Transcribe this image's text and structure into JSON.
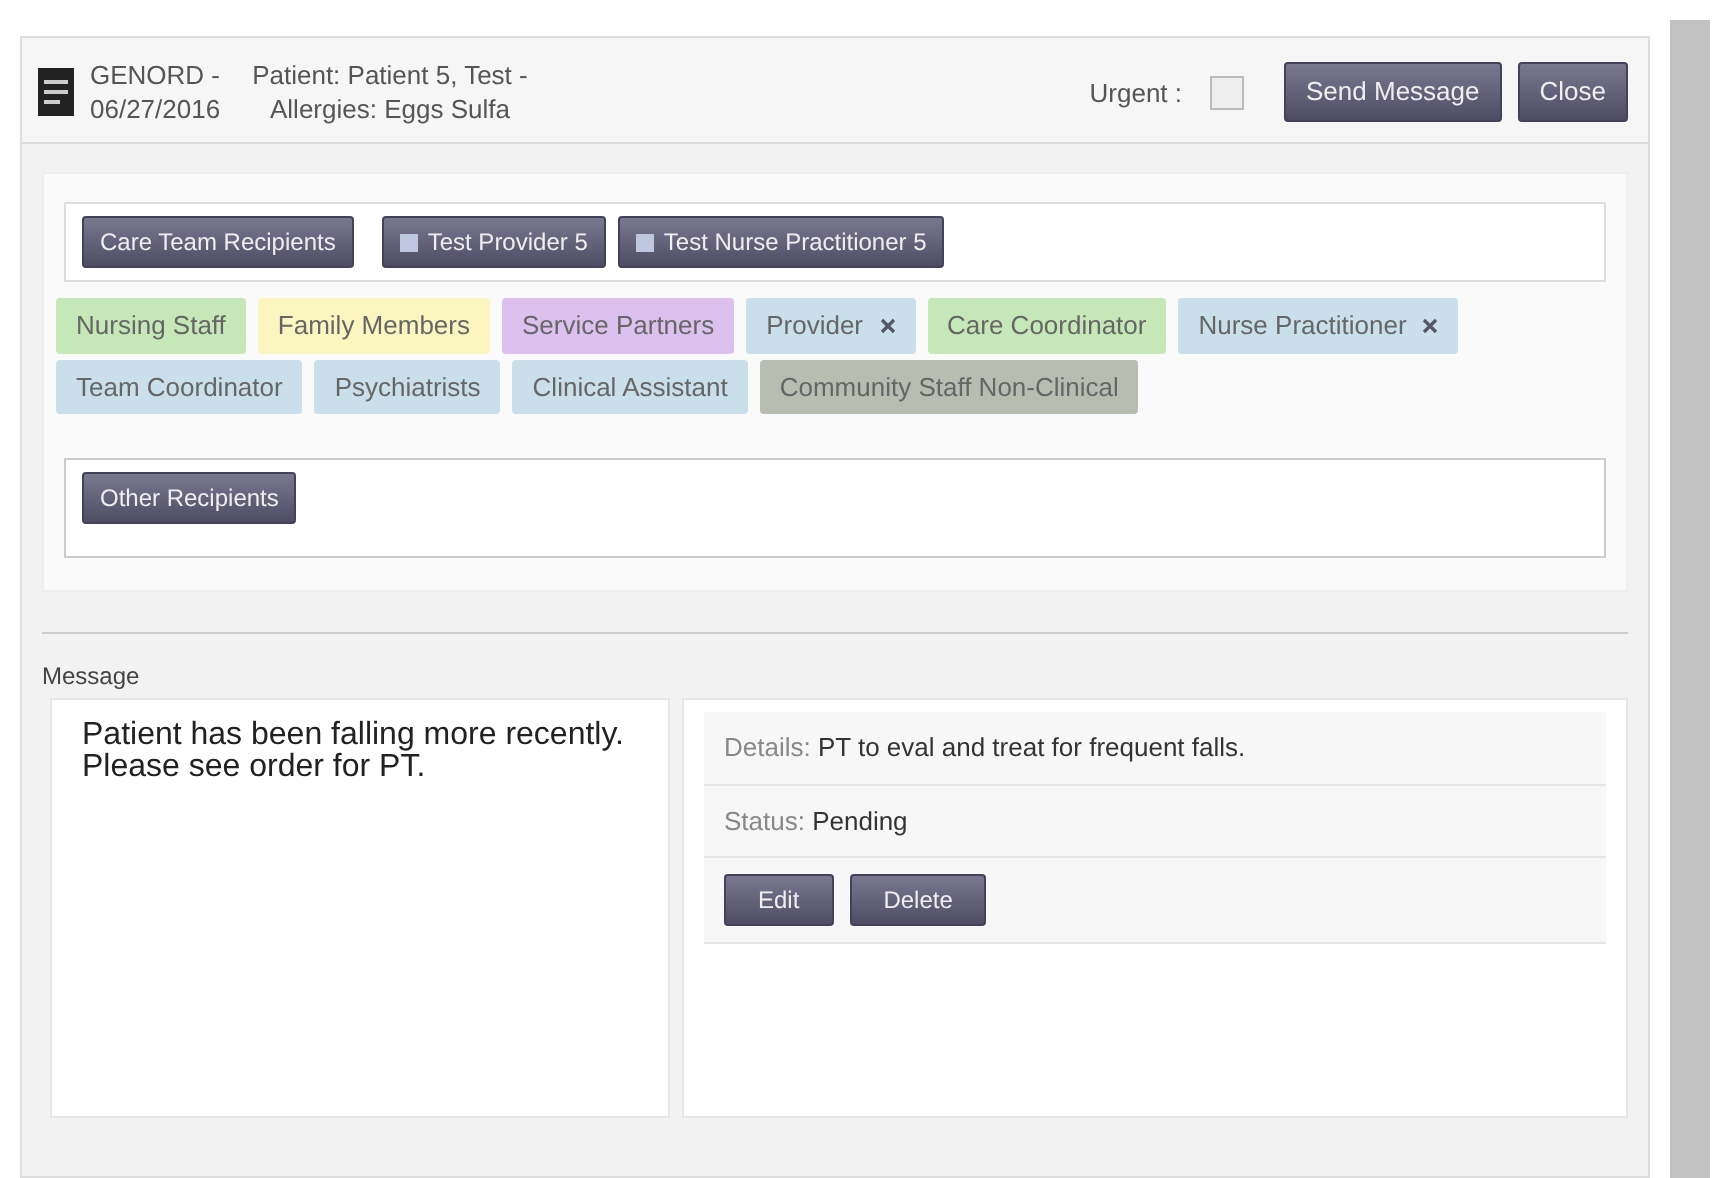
{
  "header": {
    "order": "GENORD -",
    "date": "06/27/2016",
    "patient": "Patient: Patient 5, Test -",
    "allergies": "Allergies: Eggs Sulfa",
    "urgent_label": "Urgent :",
    "urgent_checked": false,
    "buttons": [
      "Send Message",
      "Close"
    ]
  },
  "care_team": {
    "button": "Care Team Recipients",
    "recipients": [
      "Test Provider 5",
      "Test Nurse Practitioner 5"
    ]
  },
  "tags": [
    {
      "label": "Nursing Staff",
      "color": "#c6e8b8",
      "removable": false
    },
    {
      "label": "Family Members",
      "color": "#fbf6c0",
      "removable": false
    },
    {
      "label": "Service Partners",
      "color": "#dcc0ee",
      "removable": false
    },
    {
      "label": "Provider",
      "color": "#c9dfea",
      "removable": true
    },
    {
      "label": "Care Coordinator",
      "color": "#c6e8b8",
      "removable": false
    },
    {
      "label": "Nurse Practitioner",
      "color": "#c9dfea",
      "removable": true
    },
    {
      "label": "Team Coordinator",
      "color": "#c9dfea",
      "removable": false
    },
    {
      "label": "Psychiatrists",
      "color": "#c9dfea",
      "removable": false
    },
    {
      "label": "Clinical Assistant",
      "color": "#c9dfea",
      "removable": false
    },
    {
      "label": "Community Staff Non-Clinical",
      "color": "#b7bdb0",
      "removable": false
    }
  ],
  "other": {
    "button": "Other Recipients"
  },
  "message": {
    "label": "Message",
    "text": "Patient has been falling more recently. Please see order for PT.",
    "details_label": "Details:",
    "details": "PT to eval and treat for frequent falls.",
    "status_label": "Status:",
    "status": "Pending",
    "buttons": [
      "Edit",
      "Delete"
    ]
  }
}
